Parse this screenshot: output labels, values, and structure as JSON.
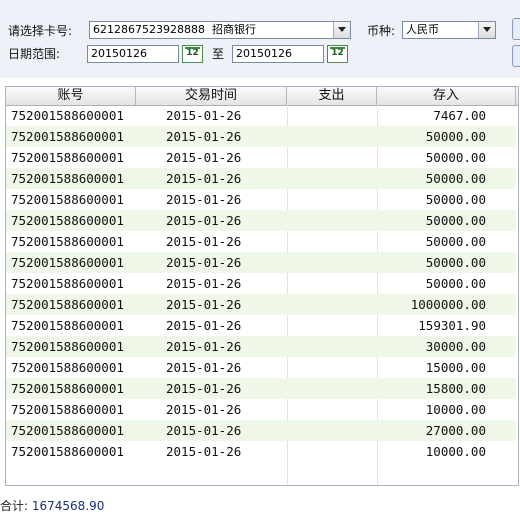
{
  "filters": {
    "card_label": "请选择卡号:",
    "card_number": "6212867523928888",
    "card_bank": "招商银行",
    "currency_label": "币种:",
    "currency_value": "人民币",
    "date_label": "日期范围:",
    "date_from": "20150126",
    "date_to_label": "至",
    "date_to": "20150126",
    "calendar_icon_text": "12"
  },
  "table": {
    "columns": [
      "账号",
      "交易时间",
      "支出",
      "存入"
    ],
    "rows": [
      {
        "account": "752001588600001",
        "time": "2015-01-26",
        "expense": "",
        "deposit": "7467.00"
      },
      {
        "account": "752001588600001",
        "time": "2015-01-26",
        "expense": "",
        "deposit": "50000.00"
      },
      {
        "account": "752001588600001",
        "time": "2015-01-26",
        "expense": "",
        "deposit": "50000.00"
      },
      {
        "account": "752001588600001",
        "time": "2015-01-26",
        "expense": "",
        "deposit": "50000.00"
      },
      {
        "account": "752001588600001",
        "time": "2015-01-26",
        "expense": "",
        "deposit": "50000.00"
      },
      {
        "account": "752001588600001",
        "time": "2015-01-26",
        "expense": "",
        "deposit": "50000.00"
      },
      {
        "account": "752001588600001",
        "time": "2015-01-26",
        "expense": "",
        "deposit": "50000.00"
      },
      {
        "account": "752001588600001",
        "time": "2015-01-26",
        "expense": "",
        "deposit": "50000.00"
      },
      {
        "account": "752001588600001",
        "time": "2015-01-26",
        "expense": "",
        "deposit": "50000.00"
      },
      {
        "account": "752001588600001",
        "time": "2015-01-26",
        "expense": "",
        "deposit": "1000000.00"
      },
      {
        "account": "752001588600001",
        "time": "2015-01-26",
        "expense": "",
        "deposit": "159301.90"
      },
      {
        "account": "752001588600001",
        "time": "2015-01-26",
        "expense": "",
        "deposit": "30000.00"
      },
      {
        "account": "752001588600001",
        "time": "2015-01-26",
        "expense": "",
        "deposit": "15000.00"
      },
      {
        "account": "752001588600001",
        "time": "2015-01-26",
        "expense": "",
        "deposit": "15800.00"
      },
      {
        "account": "752001588600001",
        "time": "2015-01-26",
        "expense": "",
        "deposit": "10000.00"
      },
      {
        "account": "752001588600001",
        "time": "2015-01-26",
        "expense": "",
        "deposit": "27000.00"
      },
      {
        "account": "752001588600001",
        "time": "2015-01-26",
        "expense": "",
        "deposit": "10000.00"
      }
    ]
  },
  "footer": {
    "total_label": "合计:",
    "total_value": "1674568.90"
  }
}
